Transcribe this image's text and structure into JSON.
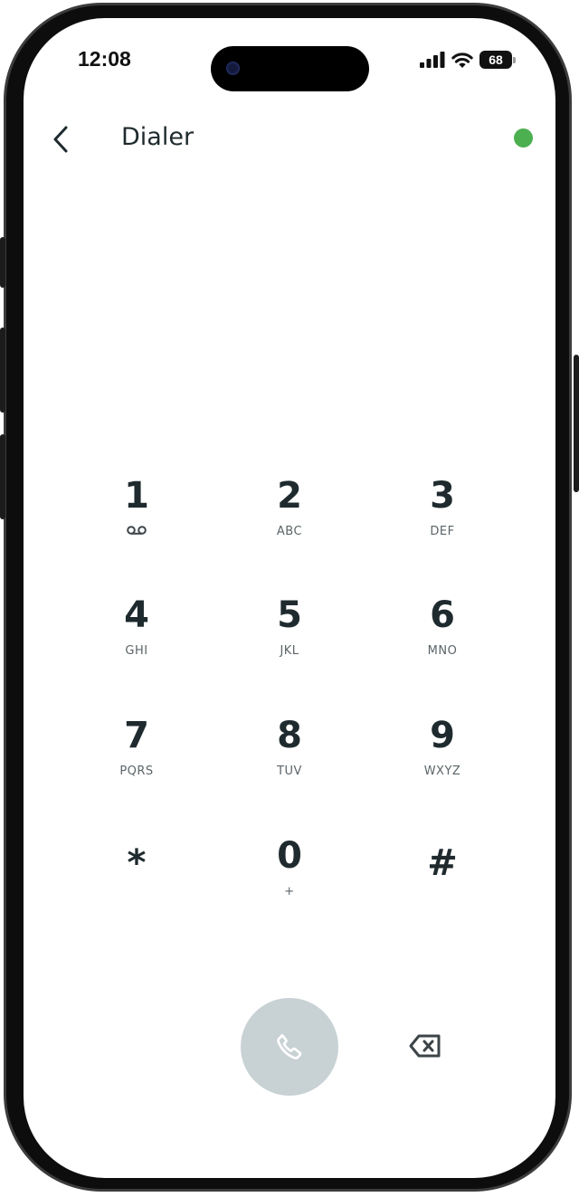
{
  "status_bar": {
    "time": "12:08",
    "battery": "68",
    "icons": [
      "signal-icon",
      "wifi-icon",
      "battery-icon"
    ]
  },
  "header": {
    "back_icon": "chevron-left-icon",
    "title": "Dialer",
    "status_color": "#4caf50"
  },
  "keypad": {
    "keys": [
      {
        "digit": "1",
        "letters": "",
        "sub_icon": "voicemail-icon"
      },
      {
        "digit": "2",
        "letters": "ABC"
      },
      {
        "digit": "3",
        "letters": "DEF"
      },
      {
        "digit": "4",
        "letters": "GHI"
      },
      {
        "digit": "5",
        "letters": "JKL"
      },
      {
        "digit": "6",
        "letters": "MNO"
      },
      {
        "digit": "7",
        "letters": "PQRS"
      },
      {
        "digit": "8",
        "letters": "TUV"
      },
      {
        "digit": "9",
        "letters": "WXYZ"
      },
      {
        "digit": "*",
        "letters": ""
      },
      {
        "digit": "0",
        "letters": "+"
      },
      {
        "digit": "#",
        "letters": ""
      }
    ]
  },
  "actions": {
    "call_icon": "phone-icon",
    "call_color": "#c8d1d4",
    "delete_icon": "backspace-icon"
  },
  "colors": {
    "text": "#1e2a2e",
    "subtext": "#5b6468"
  }
}
